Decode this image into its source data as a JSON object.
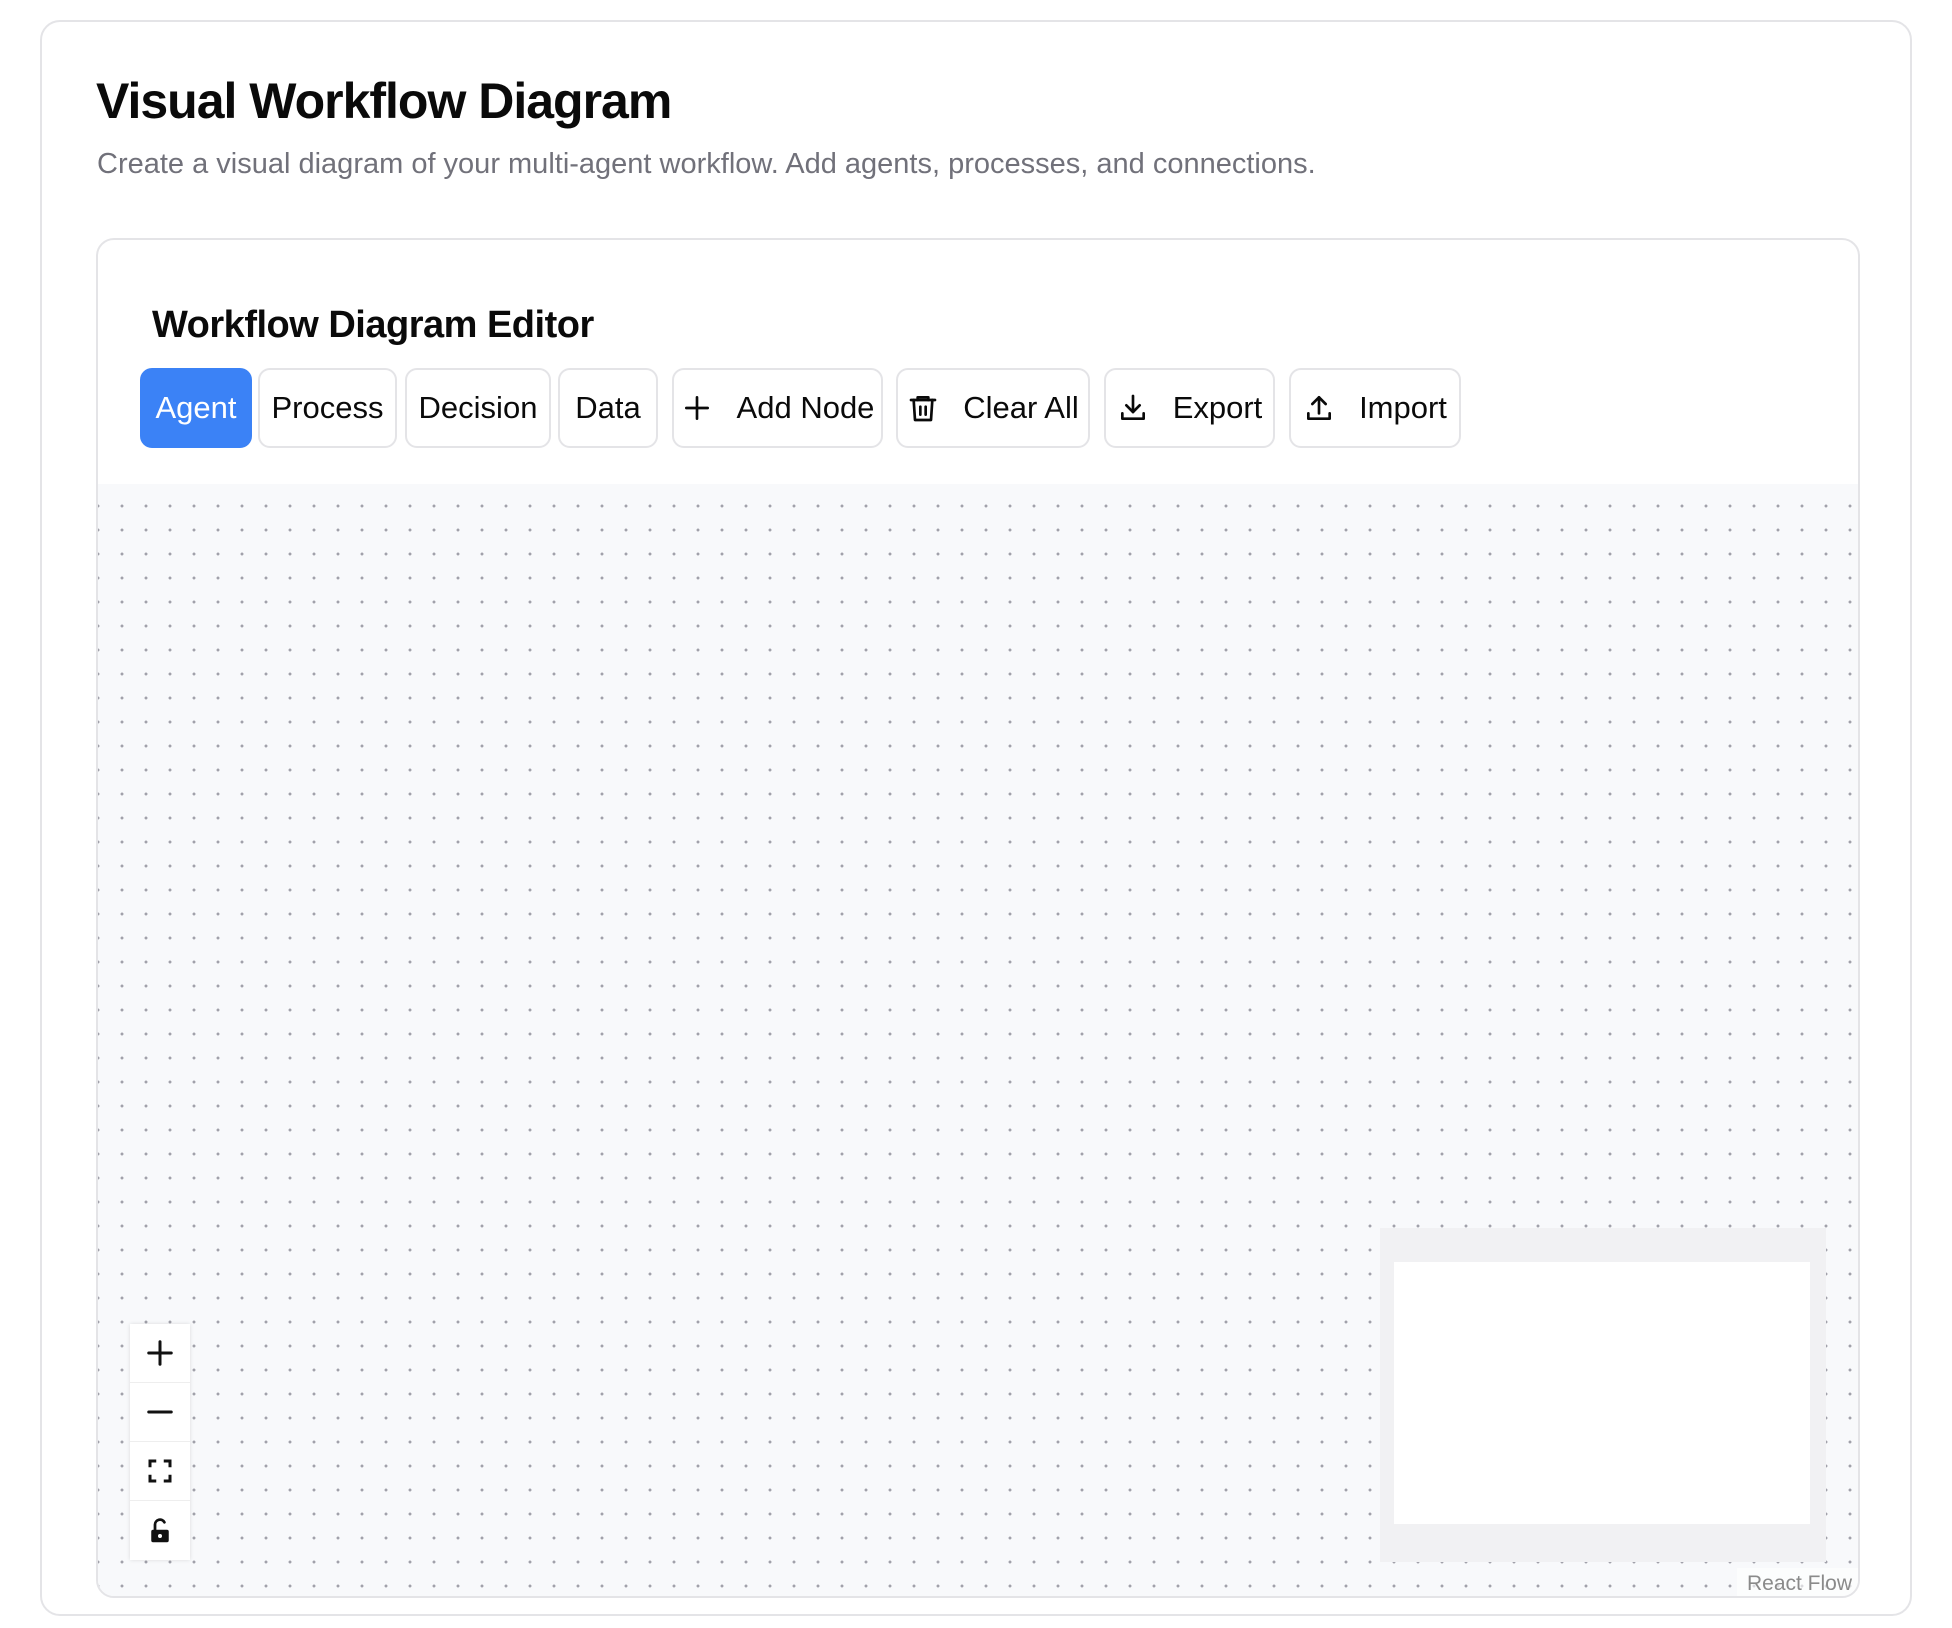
{
  "page": {
    "title": "Visual Workflow Diagram",
    "subtitle": "Create a visual diagram of your multi-agent workflow. Add agents, processes, and connections."
  },
  "editor": {
    "title": "Workflow Diagram Editor",
    "node_types": [
      {
        "label": "Agent",
        "selected": true
      },
      {
        "label": "Process",
        "selected": false
      },
      {
        "label": "Decision",
        "selected": false
      },
      {
        "label": "Data",
        "selected": false
      }
    ],
    "actions": {
      "add_node": {
        "label": "Add Node",
        "icon": "plus-icon"
      },
      "clear_all": {
        "label": "Clear All",
        "icon": "trash-icon"
      },
      "export": {
        "label": "Export",
        "icon": "download-icon"
      },
      "import": {
        "label": "Import",
        "icon": "upload-icon"
      }
    }
  },
  "canvas": {
    "controls": [
      {
        "icon": "zoom-in-icon"
      },
      {
        "icon": "zoom-out-icon"
      },
      {
        "icon": "fit-view-icon"
      },
      {
        "icon": "lock-icon"
      }
    ],
    "attribution": "React Flow"
  },
  "colors": {
    "accent": "#3b82f6",
    "canvas_bg": "#f8f9fb",
    "border": "#e4e4e7",
    "muted_text": "#71717a"
  }
}
